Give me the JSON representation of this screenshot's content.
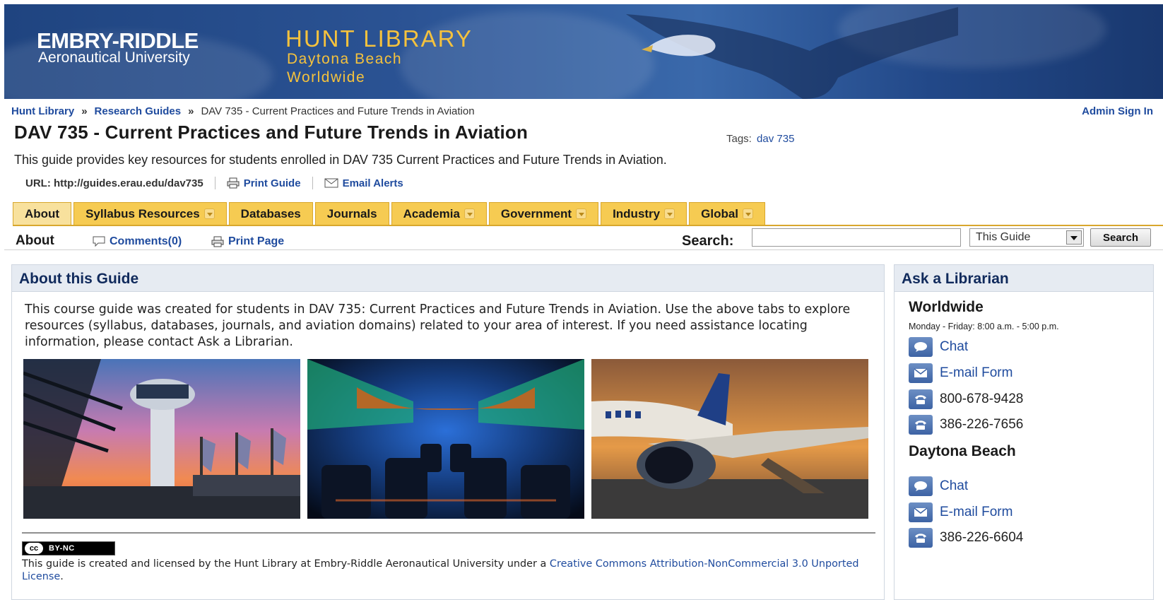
{
  "banner": {
    "university_name": "EMBRY-RIDDLE",
    "university_sub": "Aeronautical University",
    "library_title": "HUNT LIBRARY",
    "library_line1": "Daytona Beach",
    "library_line2": "Worldwide"
  },
  "breadcrumb": {
    "items": [
      "Hunt Library",
      "Research Guides",
      "DAV 735 - Current Practices and Future Trends in Aviation"
    ],
    "separator": "»"
  },
  "admin_sign_in": "Admin Sign In",
  "guide": {
    "title": "DAV 735 - Current Practices and Future Trends in Aviation",
    "tags_label": "Tags:",
    "tag": "dav 735",
    "description": "This guide provides key resources for students enrolled in DAV 735 Current Practices and Future Trends in Aviation.",
    "url_text": "URL: http://guides.erau.edu/dav735",
    "print_guide": "Print Guide",
    "email_alerts": "Email Alerts"
  },
  "tabs": [
    {
      "label": "About",
      "dropdown": false,
      "active": true
    },
    {
      "label": "Syllabus Resources",
      "dropdown": true,
      "active": false
    },
    {
      "label": "Databases",
      "dropdown": false,
      "active": false
    },
    {
      "label": "Journals",
      "dropdown": false,
      "active": false
    },
    {
      "label": "Academia",
      "dropdown": true,
      "active": false
    },
    {
      "label": "Government",
      "dropdown": true,
      "active": false
    },
    {
      "label": "Industry",
      "dropdown": true,
      "active": false
    },
    {
      "label": "Global",
      "dropdown": true,
      "active": false
    }
  ],
  "subbar": {
    "page_title": "About",
    "comments": "Comments(0)",
    "print_page": "Print Page",
    "search_label": "Search:",
    "search_value": "",
    "scope_selected": "This Guide",
    "search_button": "Search"
  },
  "main_box": {
    "header": "About this Guide",
    "body": "This course guide was created for students in DAV 735: Current Practices and Future Trends in Aviation. Use the above tabs to explore resources (syllabus, databases, journals, and aviation domains) related to your area of interest. If you need assistance locating information, please contact Ask a Librarian.",
    "license_badge_circle": "cc",
    "license_badge_label": "BY-NC",
    "license_text": "This guide is created and licensed by the Hunt Library at Embry-Riddle Aeronautical University under a ",
    "license_link_text": "Creative Commons Attribution-NonCommercial 3.0 Unported License",
    "license_end": "."
  },
  "side_box": {
    "header": "Ask a Librarian",
    "worldwide": {
      "title": "Worldwide",
      "hours": "Monday - Friday: 8:00 a.m. - 5:00 p.m.",
      "chat": "Chat",
      "email": "E-mail Form",
      "phone1": "800-678-9428",
      "phone2": "386-226-7656"
    },
    "daytona": {
      "title": "Daytona Beach",
      "chat": "Chat",
      "email": "E-mail Form",
      "phone1": "386-226-6604"
    }
  },
  "colors": {
    "tab_bg": "#f6cb52",
    "link": "#1f4b9e",
    "header_gold": "#f5c23d",
    "banner_blue": "#2b5394"
  }
}
